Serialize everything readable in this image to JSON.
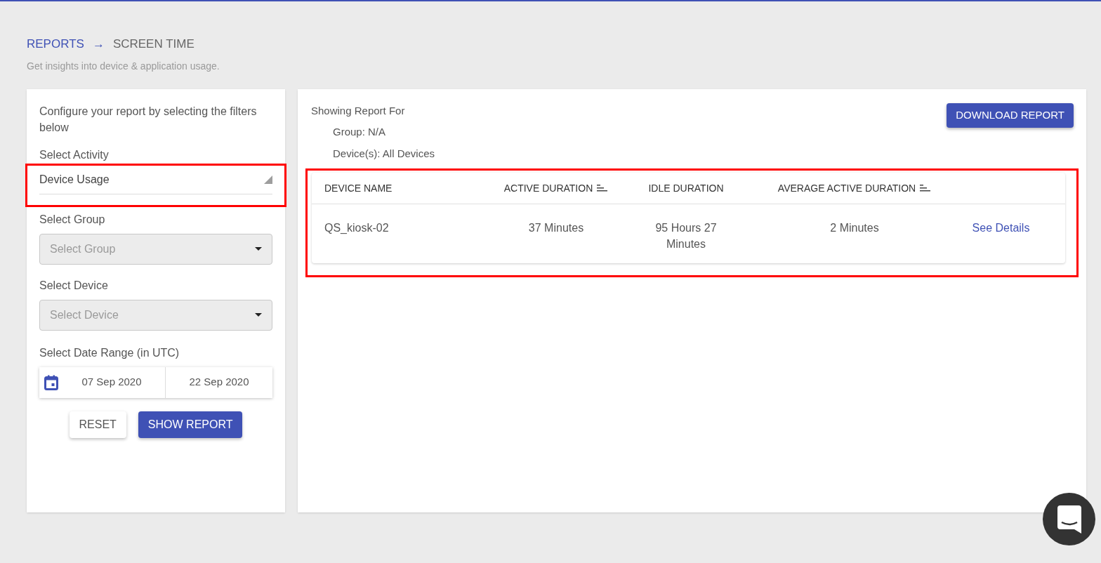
{
  "breadcrumb": {
    "parent": "REPORTS",
    "arrow": "→",
    "current": "SCREEN TIME"
  },
  "subtitle": "Get insights into device & application usage.",
  "filters": {
    "intro": "Configure your report by selecting the filters below",
    "activity": {
      "label": "Select Activity",
      "value": "Device Usage",
      "highlighted": true
    },
    "group": {
      "label": "Select Group",
      "placeholder": "Select Group",
      "disabled": true
    },
    "device": {
      "label": "Select Device",
      "placeholder": "Select Device",
      "disabled": true
    },
    "date_range": {
      "label": "Select Date Range (in UTC)",
      "start": "07 Sep 2020",
      "end": "22 Sep 2020"
    },
    "buttons": [
      {
        "label": "RESET",
        "kind": "secondary"
      },
      {
        "label": "SHOW REPORT",
        "kind": "primary"
      }
    ]
  },
  "report": {
    "heading": "Showing Report For",
    "group_label": "Group:",
    "group_value": "N/A",
    "devices_label": "Device(s):",
    "devices_value": "All Devices",
    "download": "DOWNLOAD REPORT",
    "table": {
      "highlighted": true,
      "columns": [
        {
          "label": "DEVICE NAME",
          "sortable": false
        },
        {
          "label": "ACTIVE DURATION",
          "sortable": true
        },
        {
          "label": "IDLE DURATION",
          "sortable": false
        },
        {
          "label": "AVERAGE ACTIVE DURATION",
          "sortable": true
        }
      ],
      "rows": [
        {
          "device": "QS_kiosk-02",
          "active": "37 Minutes",
          "idle": "95 Hours 27 Minutes",
          "average": "2 Minutes",
          "link": "See Details"
        }
      ]
    }
  }
}
